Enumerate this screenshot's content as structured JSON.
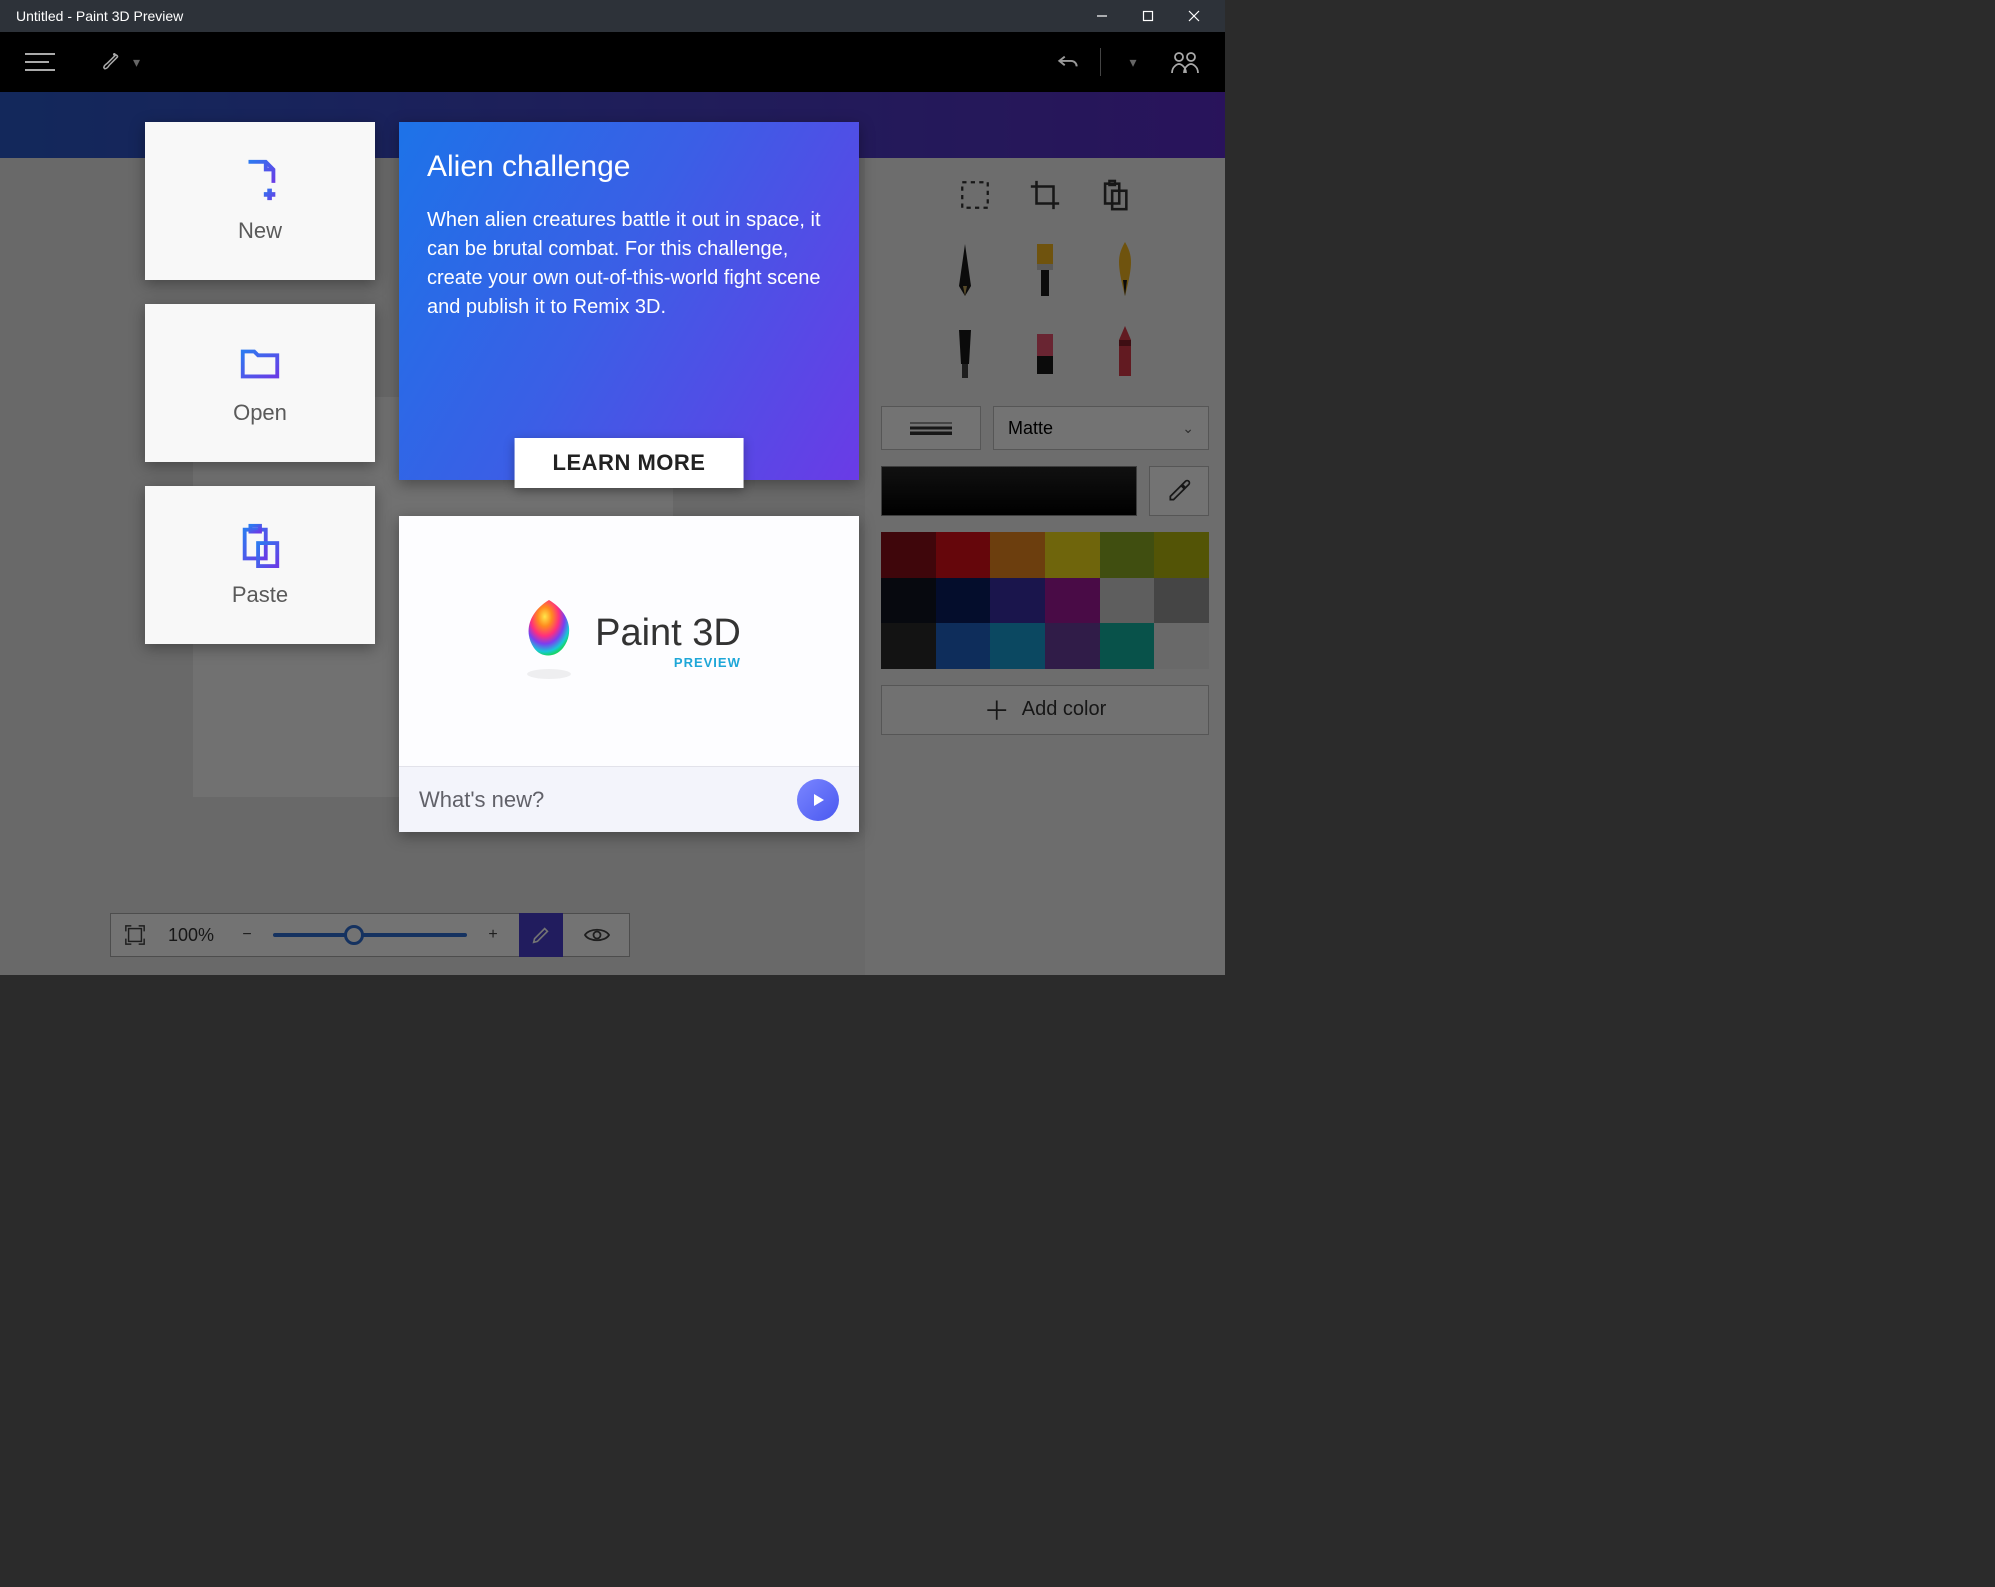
{
  "window": {
    "title": "Untitled - Paint 3D Preview"
  },
  "welcome": {
    "tiles": {
      "new": "New",
      "open": "Open",
      "paste": "Paste"
    },
    "challenge": {
      "title": "Alien challenge",
      "body": "When alien creatures battle it out in space, it can be brutal combat. For this challenge, create your own out-of-this-world fight scene and publish it to Remix 3D.",
      "button": "LEARN MORE"
    },
    "whatsnew": {
      "logo_main": "Paint 3D",
      "logo_sub": "PREVIEW",
      "footer": "What's new?"
    }
  },
  "side": {
    "material_label": "Matte",
    "add_color": "Add color",
    "palette": [
      "#8c0e1a",
      "#e00f1a",
      "#f08a1f",
      "#f7e11c",
      "#8fae24",
      "#b8bb0e",
      "#101622",
      "#0a1e63",
      "#3a2fa8",
      "#a21a9c",
      "#d0d0d0",
      "#9a9a9a",
      "#2a2a2a",
      "#2065c9",
      "#1aa0d8",
      "#6a3fa0",
      "#13b7a4",
      "#e9e9e9"
    ]
  },
  "bottombar": {
    "zoom": "100%"
  }
}
